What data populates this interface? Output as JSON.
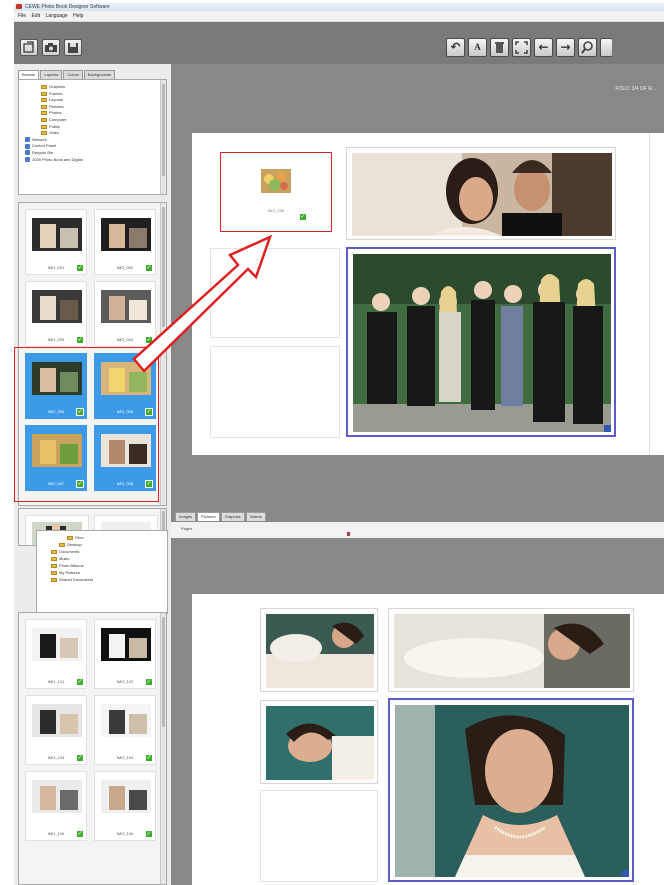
{
  "window": {
    "title": "CEWE Photo Book Designer Software"
  },
  "menu": {
    "items": [
      "File",
      "Edit",
      "Language",
      "Help"
    ]
  },
  "toolbar": {
    "left_buttons": [
      "import-icon",
      "camera-icon",
      "save-icon"
    ],
    "right_buttons": [
      "undo-icon",
      "text-icon",
      "delete-icon",
      "fit-icon",
      "prev-icon",
      "next-icon",
      "zoom-icon"
    ]
  },
  "top_workspace": {
    "tabs": [
      "Browse",
      "Layouts",
      "Colors",
      "Backgrounds"
    ],
    "header_text": "FOLD: 3/4 OF R..."
  },
  "tree1": [
    {
      "label": "Graphics",
      "indent": 2
    },
    {
      "label": "Frames",
      "indent": 2
    },
    {
      "label": "Layouts",
      "indent": 2
    },
    {
      "label": "Pictures",
      "indent": 2
    },
    {
      "label": "Photos",
      "indent": 2
    },
    {
      "label": "Computer",
      "indent": 2
    },
    {
      "label": "Public",
      "indent": 2
    },
    {
      "label": "Video",
      "indent": 2
    },
    {
      "label": "Network",
      "indent": 0
    },
    {
      "label": "Control Panel",
      "indent": 0
    },
    {
      "label": "Recycle Bin",
      "indent": 0
    },
    {
      "label": "2009 Photo Book and Digital",
      "indent": 0
    }
  ],
  "thumbs1": [
    {
      "caption": "IMG_001"
    },
    {
      "caption": "IMG_002"
    },
    {
      "caption": "IMG_003"
    },
    {
      "caption": "IMG_004"
    },
    {
      "caption": "IMG_005"
    },
    {
      "caption": "IMG_006"
    },
    {
      "caption": "IMG_007"
    },
    {
      "caption": "IMG_008"
    }
  ],
  "dropped_caption": "IMG_006",
  "bottom_workspace": {
    "tabs": [
      "Images",
      "Pictures",
      "Graphics",
      "Videos"
    ],
    "subtext": "Pages"
  },
  "tree2": [
    {
      "label": "Files",
      "indent": 3
    },
    {
      "label": "Desktop",
      "indent": 2
    },
    {
      "label": "Documents",
      "indent": 1
    },
    {
      "label": "Music",
      "indent": 1
    },
    {
      "label": "Photo Albums",
      "indent": 1
    },
    {
      "label": "My Pictures",
      "indent": 1
    },
    {
      "label": "Shared Documents",
      "indent": 1
    }
  ],
  "thumbs2": [
    {
      "caption": "IMG_101"
    },
    {
      "caption": "IMG_102"
    },
    {
      "caption": "IMG_103"
    },
    {
      "caption": "IMG_104"
    },
    {
      "caption": "IMG_105"
    },
    {
      "caption": "IMG_106"
    }
  ],
  "colors": {
    "selection": "#3d9ae8",
    "highlight_frame": "#e02020",
    "check": "#3fae2a"
  }
}
